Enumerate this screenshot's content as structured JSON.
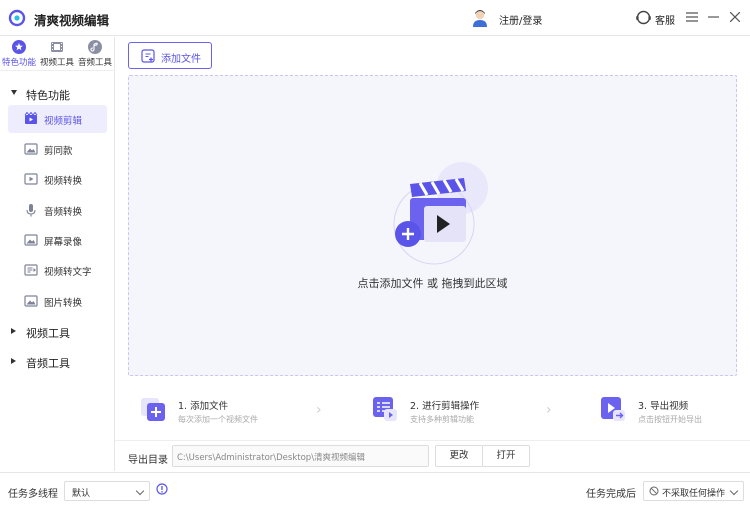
{
  "app": {
    "title": "清爽视频编辑"
  },
  "header": {
    "login_label": "注册/登录",
    "service_label": "客服"
  },
  "sidebar": {
    "tabs": [
      {
        "label": "特色功能",
        "icon": "star-icon"
      },
      {
        "label": "视频工具",
        "icon": "film-icon"
      },
      {
        "label": "音频工具",
        "icon": "audio-icon"
      }
    ],
    "groups": [
      {
        "label": "特色功能",
        "expanded": true
      },
      {
        "label": "视频工具",
        "expanded": false
      },
      {
        "label": "音频工具",
        "expanded": false
      }
    ],
    "items": [
      {
        "label": "视频剪辑",
        "icon": "video-edit-icon",
        "active": true
      },
      {
        "label": "剪同款",
        "icon": "image-icon"
      },
      {
        "label": "视频转换",
        "icon": "video-convert-icon"
      },
      {
        "label": "音频转换",
        "icon": "microphone-icon"
      },
      {
        "label": "屏幕录像",
        "icon": "image-icon"
      },
      {
        "label": "视频转文字",
        "icon": "video-to-text-icon"
      },
      {
        "label": "图片转换",
        "icon": "image-icon"
      }
    ]
  },
  "main": {
    "add_file_label": "添加文件",
    "drop_text": "点击添加文件 或 拖拽到此区域",
    "steps": [
      {
        "title": "1. 添加文件",
        "desc": "每次添加一个视频文件"
      },
      {
        "title": "2. 进行剪辑操作",
        "desc": "支持多种剪辑功能"
      },
      {
        "title": "3. 导出视频",
        "desc": "点击按钮开始导出"
      }
    ],
    "export_label": "导出目录",
    "export_path": "C:\\Users\\Administrator\\Desktop\\清爽视频编辑",
    "change_label": "更改",
    "open_label": "打开"
  },
  "bottom": {
    "thread_label": "任务多线程",
    "thread_value": "默认",
    "after_label": "任务完成后",
    "after_value": "不采取任何操作"
  },
  "colors": {
    "accent": "#5b54e8",
    "dropzone_bg": "#f5f6fb"
  }
}
